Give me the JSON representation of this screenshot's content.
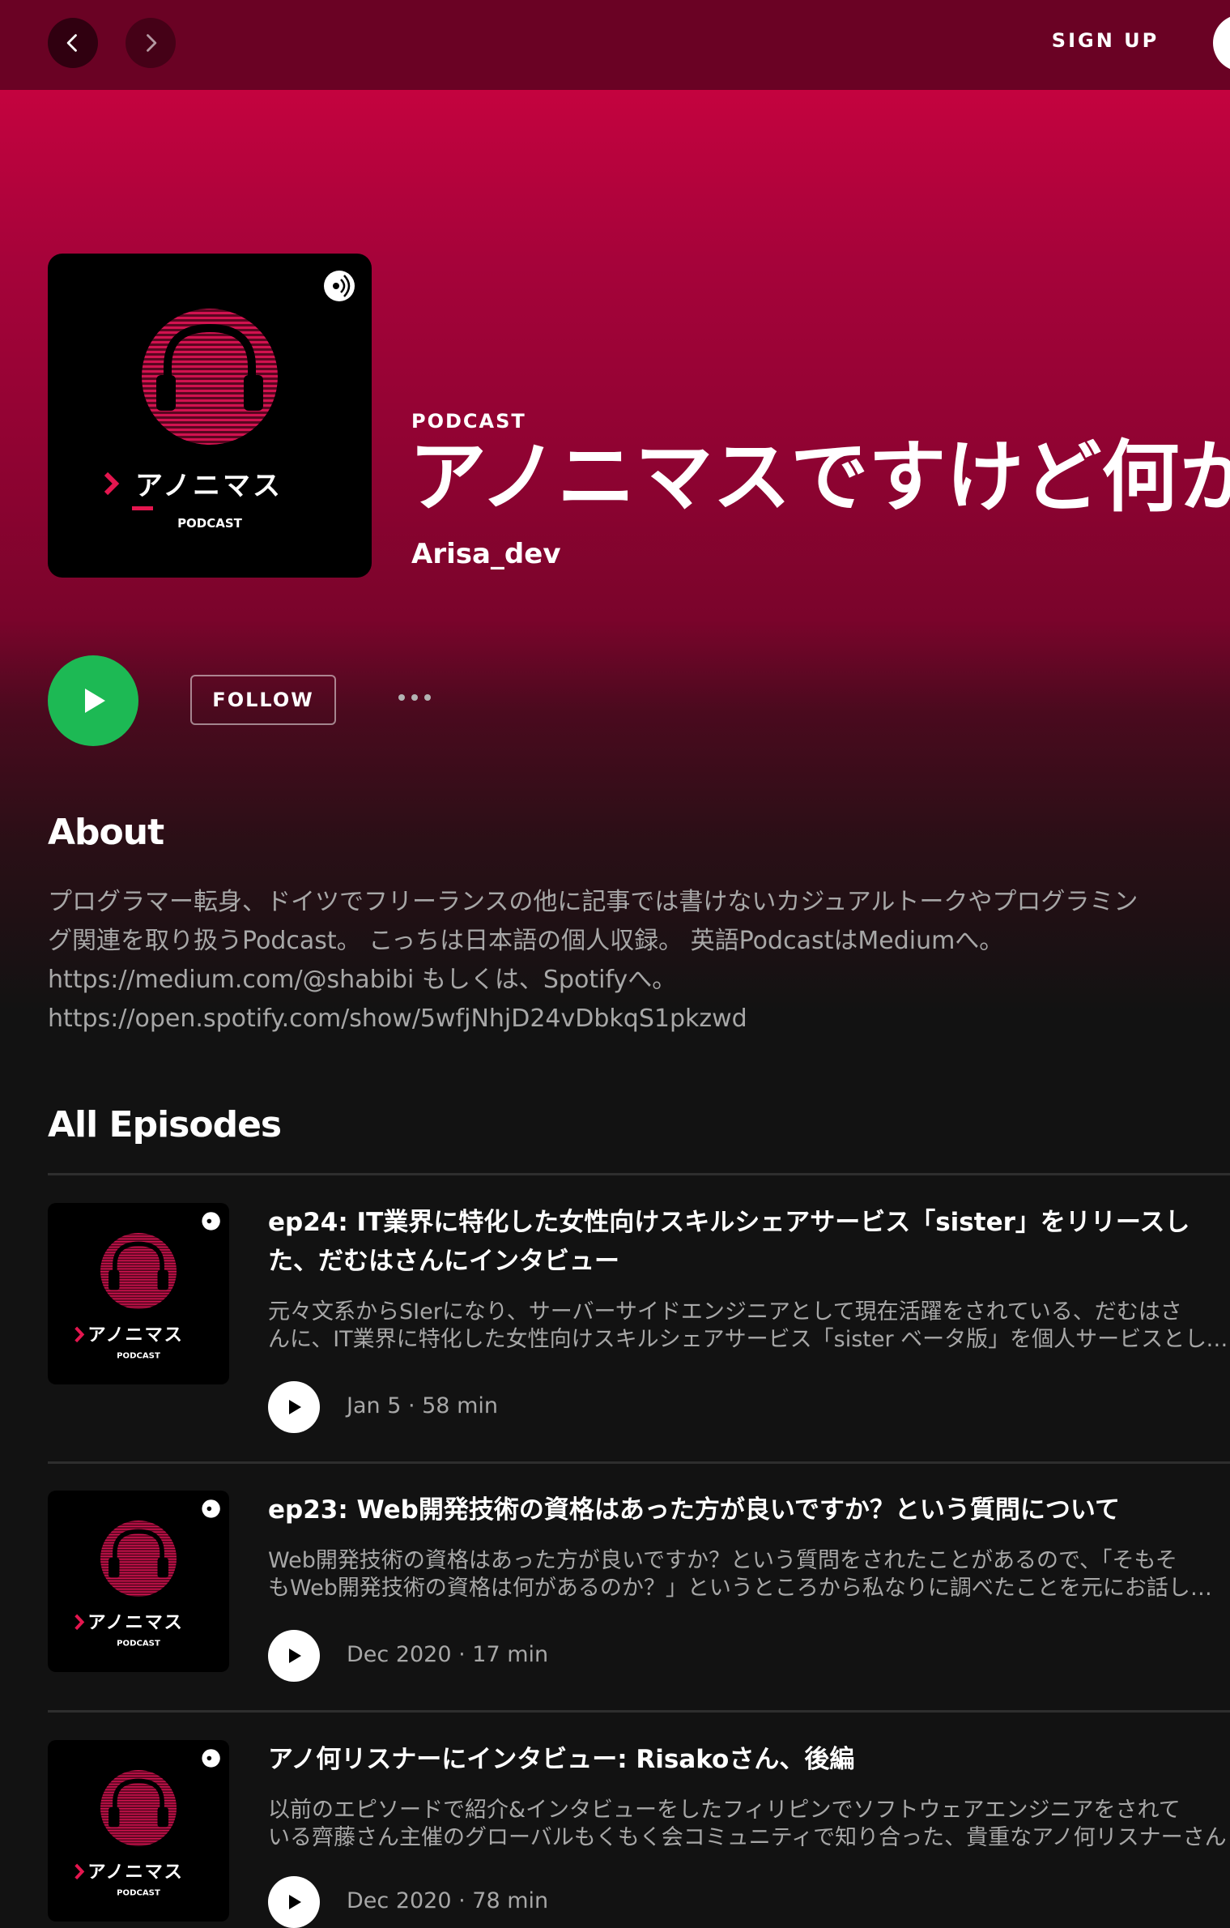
{
  "topbar": {
    "signup_label": "SIGN UP"
  },
  "show": {
    "type": "PODCAST",
    "title": "アノニマスですけど何か",
    "publisher": "Arisa_dev",
    "cover": {
      "brand_text": "アノニマス",
      "brand_sub": "PODCAST"
    }
  },
  "actions": {
    "follow_label": "FOLLOW"
  },
  "about": {
    "heading": "About",
    "lines": [
      "プログラマー転身、ドイツでフリーランスの他に記事では書けないカジュアルトークやプログラミン",
      "グ関連を取り扱うPodcast。 こっちは日本語の個人収録。 英語PodcastはMediumへ。",
      "https://medium.com/@shabibi もしくは、Spotifyへ。",
      "https://open.spotify.com/show/5wfjNhjD24vDbkqS1pkzwd"
    ]
  },
  "episodes_section": {
    "heading": "All Episodes",
    "items": [
      {
        "title_lines": [
          "ep24: IT業界に特化した女性向けスキルシェアサービス「sister」をリリースし",
          "た、だむはさんにインタビュー"
        ],
        "desc_lines": [
          "元々文系からSIerになり、サーバーサイドエンジニアとして現在活躍をされている、だむはさ",
          "んに、IT業界に特化した女性向けスキルシェアサービス「sister ベータ版」を個人サービスとしてリリースされた"
        ],
        "meta": "Jan 5 · 58 min"
      },
      {
        "title_lines": [
          "ep23: Web開発技術の資格はあった方が良いですか？という質問について"
        ],
        "desc_lines": [
          "Web開発技術の資格はあった方が良いですか？という質問をされたことがあるので、「そもそ",
          "もWeb開発技術の資格は何があるのか？」というところから私なりに調べたことを元にお話しします"
        ],
        "meta": "Dec 2020 · 17 min"
      },
      {
        "title_lines": [
          "アノ何リスナーにインタビュー: Risakoさん、後編"
        ],
        "desc_lines": [
          "以前のエピソードで紹介&インタビューをしたフィリピンでソフトウェアエンジニアをされて",
          "いる齊藤さん主催のグローバルもくもく会コミュニティで知り合った、貴重なアノ何リスナーさん"
        ],
        "meta": "Dec 2020 · 78 min"
      }
    ]
  },
  "colors": {
    "accent_green": "#1db954",
    "header_red": "#c4033f",
    "background": "#121212"
  }
}
